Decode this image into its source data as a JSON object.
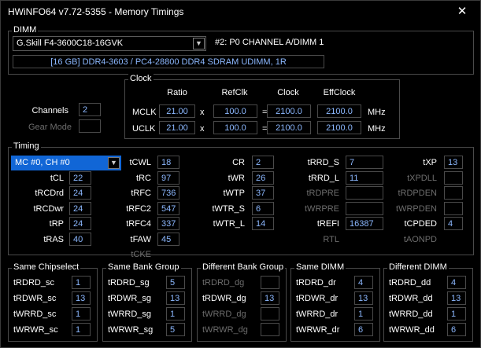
{
  "window": {
    "title": "HWiNFO64 v7.72-5355 - Memory Timings",
    "close_glyph": "✕"
  },
  "dimm": {
    "group_label": "DIMM",
    "module": "G.Skill F4-3600C18-16GVK",
    "slot": "#2: P0 CHANNEL A/DIMM 1",
    "description": "[16 GB] DDR4-3603 / PC4-28800 DDR4 SDRAM UDIMM, 1R"
  },
  "clock": {
    "group_label": "Clock",
    "headers": {
      "ratio": "Ratio",
      "refclk": "RefClk",
      "clock": "Clock",
      "effclock": "EffClock"
    },
    "mclk": {
      "label": "MCLK",
      "ratio": "21.00",
      "x": "x",
      "refclk": "100.0",
      "eq": "=",
      "clock": "2100.0",
      "effclock": "2100.0",
      "unit": "MHz"
    },
    "uclk": {
      "label": "UCLK",
      "ratio": "21.00",
      "x": "x",
      "refclk": "100.0",
      "eq": "=",
      "clock": "2100.0",
      "effclock": "2100.0",
      "unit": "MHz"
    }
  },
  "left": {
    "channels_label": "Channels",
    "channels": "2",
    "gear_label": "Gear Mode",
    "gear": ""
  },
  "timing": {
    "group_label": "Timing",
    "controller": "MC #0, CH #0",
    "col1": [
      {
        "label": "tCL",
        "value": "22"
      },
      {
        "label": "tRCDrd",
        "value": "24"
      },
      {
        "label": "tRCDwr",
        "value": "24"
      },
      {
        "label": "tRP",
        "value": "24"
      },
      {
        "label": "tRAS",
        "value": "40"
      }
    ],
    "col2": [
      {
        "label": "tCWL",
        "value": "18"
      },
      {
        "label": "tRC",
        "value": "97"
      },
      {
        "label": "tRFC",
        "value": "736"
      },
      {
        "label": "tRFC2",
        "value": "547"
      },
      {
        "label": "tRFC4",
        "value": "337"
      },
      {
        "label": "tFAW",
        "value": "45"
      },
      {
        "label": "tCKE",
        "value": ""
      }
    ],
    "col3": [
      {
        "label": "CR",
        "value": "2"
      },
      {
        "label": "tWR",
        "value": "26"
      },
      {
        "label": "tWTP",
        "value": "37"
      },
      {
        "label": "tWTR_S",
        "value": "6"
      },
      {
        "label": "tWTR_L",
        "value": "14"
      }
    ],
    "col4": [
      {
        "label": "tRRD_S",
        "value": "7"
      },
      {
        "label": "tRRD_L",
        "value": "11"
      },
      {
        "label": "tRDPRE",
        "value": ""
      },
      {
        "label": "tWRPRE",
        "value": ""
      },
      {
        "label": "tREFI",
        "value": "16387"
      },
      {
        "label": "RTL",
        "value": ""
      }
    ],
    "col5": [
      {
        "label": "tXP",
        "value": "13"
      },
      {
        "label": "tXPDLL",
        "value": ""
      },
      {
        "label": "tRDPDEN",
        "value": ""
      },
      {
        "label": "tWRPDEN",
        "value": ""
      },
      {
        "label": "tCPDED",
        "value": "4"
      },
      {
        "label": "tAONPD",
        "value": ""
      }
    ]
  },
  "groups": [
    {
      "label": "Same Chipselect",
      "rows": [
        {
          "label": "tRDRD_sc",
          "value": "1"
        },
        {
          "label": "tRDWR_sc",
          "value": "13"
        },
        {
          "label": "tWRRD_sc",
          "value": "1"
        },
        {
          "label": "tWRWR_sc",
          "value": "1"
        }
      ]
    },
    {
      "label": "Same Bank Group",
      "rows": [
        {
          "label": "tRDRD_sg",
          "value": "5"
        },
        {
          "label": "tRDWR_sg",
          "value": "13"
        },
        {
          "label": "tWRRD_sg",
          "value": "1"
        },
        {
          "label": "tWRWR_sg",
          "value": "5"
        }
      ]
    },
    {
      "label": "Different Bank Group",
      "rows": [
        {
          "label": "tRDRD_dg",
          "value": ""
        },
        {
          "label": "tRDWR_dg",
          "value": "13"
        },
        {
          "label": "tWRRD_dg",
          "value": ""
        },
        {
          "label": "tWRWR_dg",
          "value": ""
        }
      ]
    },
    {
      "label": "Same DIMM",
      "rows": [
        {
          "label": "tRDRD_dr",
          "value": "4"
        },
        {
          "label": "tRDWR_dr",
          "value": "13"
        },
        {
          "label": "tWRRD_dr",
          "value": "1"
        },
        {
          "label": "tWRWR_dr",
          "value": "6"
        }
      ]
    },
    {
      "label": "Different DIMM",
      "rows": [
        {
          "label": "tRDRD_dd",
          "value": "4"
        },
        {
          "label": "tRDWR_dd",
          "value": "13"
        },
        {
          "label": "tWRRD_dd",
          "value": "1"
        },
        {
          "label": "tWRWR_dd",
          "value": "6"
        }
      ]
    }
  ]
}
